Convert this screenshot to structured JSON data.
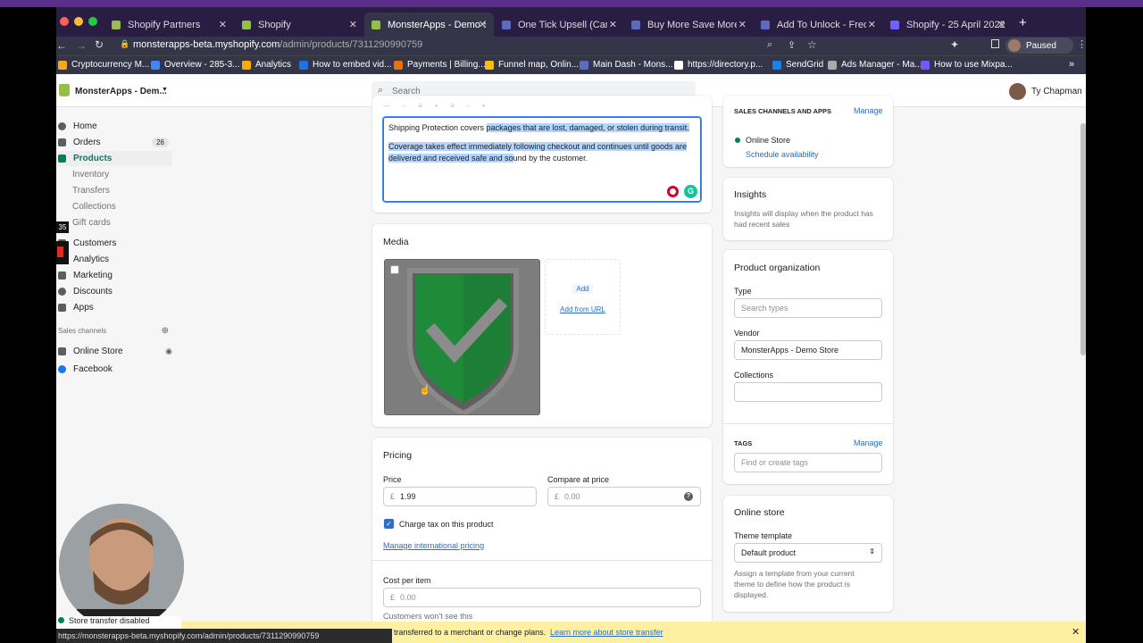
{
  "browser": {
    "tabs": [
      {
        "label": "Shopify Partners",
        "color": "#95bf47"
      },
      {
        "label": "Shopify",
        "color": "#95bf47"
      },
      {
        "label": "MonsterApps - Demo Sto",
        "color": "#95bf47"
      },
      {
        "label": "One Tick Upsell (Campai",
        "color": "#5c6ac4"
      },
      {
        "label": "Buy More Save More (Ca",
        "color": "#5c6ac4"
      },
      {
        "label": "Add To Unlock - Frequen",
        "color": "#5c6ac4"
      },
      {
        "label": "Shopify - 25 April 2022",
        "color": "#6b63ff"
      }
    ],
    "url_host": "monsterapps-beta.myshopify.com",
    "url_path": "/admin/products/7311290990759",
    "profile_status": "Paused",
    "bookmarks": [
      "Cryptocurrency M...",
      "Overview - 285-3...",
      "Analytics",
      "How to embed vid...",
      "Payments | Billing...",
      "Funnel map, Onlin...",
      "Main Dash - Mons...",
      "https://directory.p...",
      "SendGrid",
      "Ads Manager - Ma...",
      "How to use Mixpa..."
    ]
  },
  "topbar": {
    "store_name": "MonsterApps - Dem...",
    "search_placeholder": "Search",
    "user_name": "Ty Chapman"
  },
  "sidebar": {
    "items": [
      {
        "label": "Home"
      },
      {
        "label": "Orders",
        "badge": "26"
      },
      {
        "label": "Products"
      },
      {
        "label": "Inventory"
      },
      {
        "label": "Transfers"
      },
      {
        "label": "Collections"
      },
      {
        "label": "Gift cards"
      },
      {
        "label": "Customers"
      },
      {
        "label": "Analytics"
      },
      {
        "label": "Marketing"
      },
      {
        "label": "Discounts"
      },
      {
        "label": "Apps"
      }
    ],
    "sales_channels_label": "Sales channels",
    "channels": [
      "Online Store",
      "Facebook"
    ],
    "notif_count": "35"
  },
  "description": {
    "line1_plain": "Shipping Protection covers ",
    "line1_sel": "packages that are lost, damaged, or stolen during transit.",
    "line2_sel": "Coverage takes effect immediately following checkout and continues until goods are delivered and received safe and so",
    "line2_plain": "und by the customer."
  },
  "media": {
    "title": "Media",
    "add_label": "Add",
    "add_url_label": "Add from URL"
  },
  "pricing": {
    "title": "Pricing",
    "price_label": "Price",
    "currency": "£",
    "price_value": "1.99",
    "compare_label": "Compare at price",
    "compare_placeholder": "0.00",
    "charge_tax_label": "Charge tax on this product",
    "manage_intl_label": "Manage international pricing",
    "cost_label": "Cost per item",
    "cost_placeholder": "0.00",
    "cost_help": "Customers won't see this"
  },
  "right": {
    "sales_channels_title": "SALES CHANNELS AND APPS",
    "manage_label": "Manage",
    "online_store_label": "Online Store",
    "schedule_label": "Schedule availability",
    "insights_title": "Insights",
    "insights_text": "Insights will display when the product has had recent sales",
    "org_title": "Product organization",
    "type_label": "Type",
    "type_placeholder": "Search types",
    "vendor_label": "Vendor",
    "vendor_value": "MonsterApps - Demo Store",
    "collections_label": "Collections",
    "tags_title": "TAGS",
    "tags_manage": "Manage",
    "tags_placeholder": "Find or create tags",
    "online_store_title": "Online store",
    "theme_label": "Theme template",
    "theme_value": "Default product",
    "theme_help": "Assign a template from your current theme to define how the product is displayed."
  },
  "banner": {
    "left_text": "Store transfer disabled",
    "text": "transferred to a merchant or change plans.",
    "link": "Learn more about store transfer"
  },
  "status_url": "https://monsterapps-beta.myshopify.com/admin/products/7311290990759",
  "colors": {
    "shopify_green": "#008060",
    "link_blue": "#2c6ecb",
    "selection": "#b3d4fc"
  }
}
